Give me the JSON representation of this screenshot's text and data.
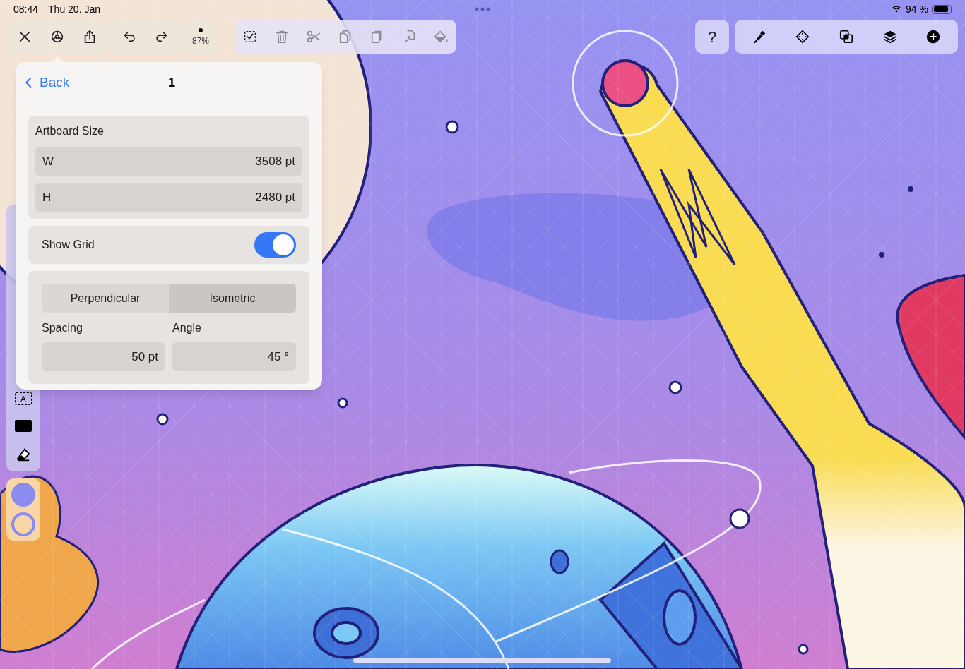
{
  "status_bar": {
    "time": "08:44",
    "date": "Thu 20. Jan",
    "battery": "94 %"
  },
  "top_toolbar": {
    "zoom": "87%"
  },
  "help_button": {
    "label": "?"
  },
  "left_toolbar": {
    "text_tool_label": "A",
    "swatches": [
      {
        "kind": "fill",
        "color": "#8b8bf0"
      },
      {
        "kind": "stroke",
        "color": "#8b8bf0"
      }
    ]
  },
  "settings_panel": {
    "back": "Back",
    "title": "1",
    "artboard": {
      "heading": "Artboard Size",
      "fields": [
        {
          "label": "W",
          "value": "3508 pt"
        },
        {
          "label": "H",
          "value": "2480 pt"
        }
      ]
    },
    "show_grid": {
      "label": "Show Grid",
      "on": true
    },
    "grid_type": [
      {
        "label": "Perpendicular",
        "selected": false
      },
      {
        "label": "Isometric",
        "selected": true
      }
    ],
    "grid_fields": [
      {
        "label": "Spacing",
        "value": "50 pt"
      },
      {
        "label": "Angle",
        "value": "45 °"
      }
    ]
  }
}
